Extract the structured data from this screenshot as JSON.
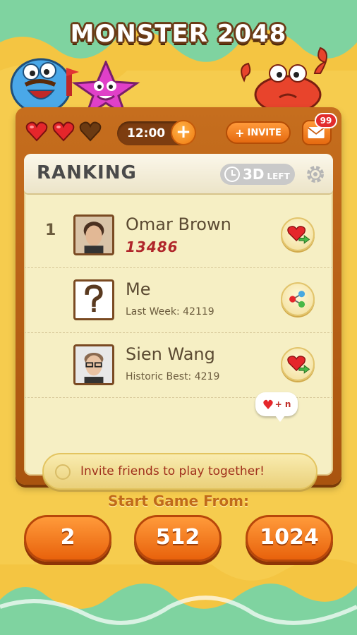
{
  "game_title": "MONSTER 2048",
  "topbar": {
    "lives": [
      "full",
      "full",
      "empty"
    ],
    "timer": "12:00",
    "invite_label": "INVITE",
    "mail_count": "99"
  },
  "ranking": {
    "title": "RANKING",
    "days_left_value": "3D",
    "days_left_suffix": "LEFT",
    "rows": [
      {
        "rank": "1",
        "name": "Omar Brown",
        "score": "13486",
        "action": "send-heart"
      },
      {
        "rank": "",
        "name": "Me",
        "sub": "Last Week: 42119",
        "action": "share"
      },
      {
        "rank": "",
        "name": "Sien Wang",
        "sub": "Historic Best: 4219",
        "action": "send-heart"
      }
    ],
    "invite_text": "Invite friends to play together!",
    "invite_bubble": "+ n"
  },
  "start": {
    "label": "Start Game From:",
    "options": [
      "2",
      "512",
      "1024"
    ]
  },
  "colors": {
    "background_green": "#7fd3a0",
    "slime_yellow": "#f4c542",
    "panel_orange": "#c66e1e",
    "button_orange": "#ff9a3a",
    "score_red": "#b0252a"
  }
}
